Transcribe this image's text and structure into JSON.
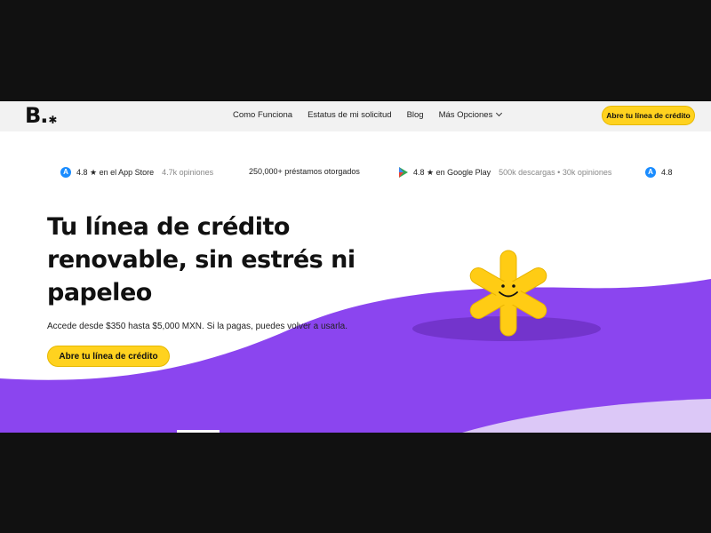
{
  "nav": {
    "logo": "B.",
    "logo_mark": "✱",
    "links": [
      "Como Funciona",
      "Estatus de mi solicitud",
      "Blog",
      "Más Opciones"
    ],
    "cta_label": "Abre tu línea de crédito"
  },
  "ratings": {
    "appstore": {
      "score": "4.8 ★ en el App Store",
      "detail": "4.7k opiniones"
    },
    "loans": {
      "label": "250,000+ préstamos otorgados"
    },
    "googleplay": {
      "score": "4.8 ★ en Google Play",
      "detail": "500k descargas • 30k opiniones"
    },
    "appstore_repeat": {
      "score": "4.8"
    }
  },
  "hero": {
    "title_line1": "Tu línea de crédito",
    "title_highlight": "renovable",
    "title_rest": ", sin estrés ni papeleo",
    "subtitle": "Accede desde $350 hasta $5,000 MXN. Si la pagas, puedes volver a usarla.",
    "cta_label": "Abre tu línea de crédito"
  },
  "colors": {
    "accent_yellow": "#ffd21f",
    "brand_purple": "#8b45ef",
    "light_purple": "#dcc8f7",
    "nav_bg": "#f2f2f2"
  },
  "icons": [
    "appstore-icon",
    "google-play-icon",
    "chevron-down-icon",
    "smiling-asterisk-mascot"
  ]
}
